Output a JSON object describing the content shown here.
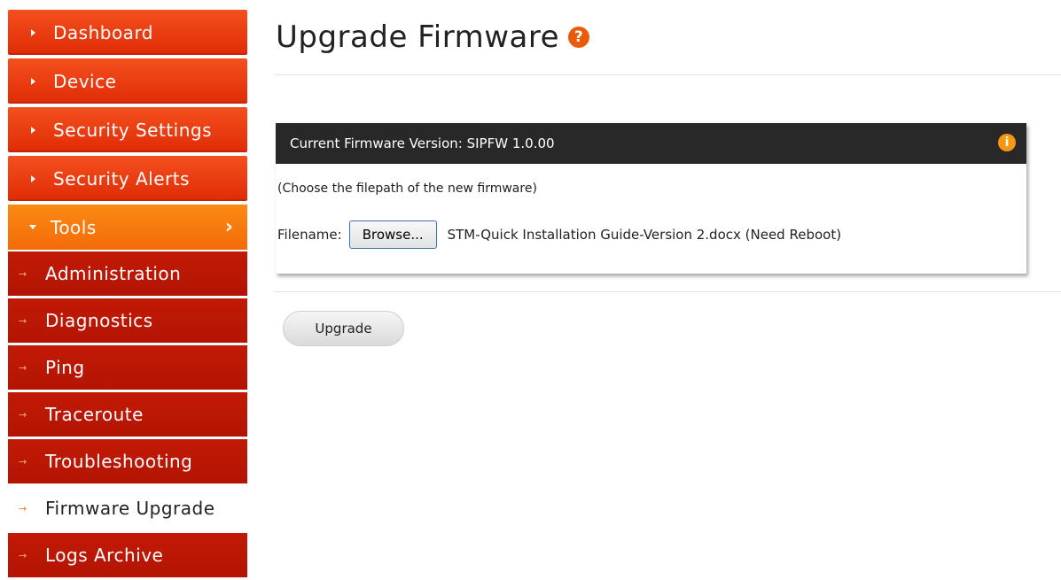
{
  "sidebar": {
    "top_items": [
      {
        "label": "Dashboard"
      },
      {
        "label": "Device"
      },
      {
        "label": "Security Settings"
      },
      {
        "label": "Security Alerts"
      }
    ],
    "tools": {
      "label": "Tools",
      "chevron": "›"
    },
    "sub_items": [
      {
        "label": "Administration"
      },
      {
        "label": "Diagnostics"
      },
      {
        "label": "Ping"
      },
      {
        "label": "Traceroute"
      },
      {
        "label": "Troubleshooting"
      },
      {
        "label": "Firmware Upgrade",
        "active": true
      },
      {
        "label": "Logs Archive"
      }
    ],
    "sub_indicator": "→"
  },
  "page": {
    "title": "Upgrade Firmware",
    "help_icon": "?"
  },
  "panel": {
    "header": "Current Firmware Version: SIPFW 1.0.00",
    "info_icon": "i",
    "hint": "(Choose the filepath of the new firmware)",
    "filename_label": "Filename:",
    "browse_label": "Browse...",
    "file_name": "STM-Quick Installation Guide-Version 2.docx (Need Reboot)"
  },
  "actions": {
    "upgrade_label": "Upgrade"
  },
  "colors": {
    "accent": "#e02b05",
    "tools": "#f46b08",
    "submenu": "#b41404",
    "header": "#282828"
  }
}
